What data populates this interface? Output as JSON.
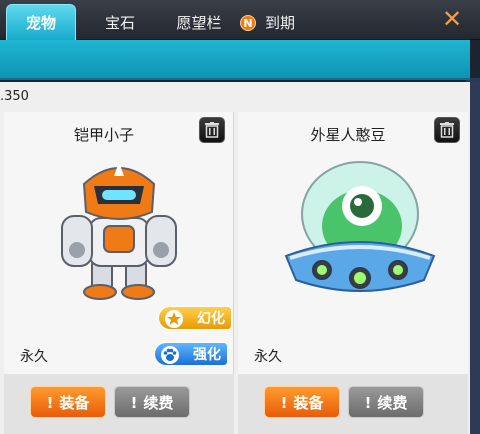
{
  "tabs": {
    "pets": "宠物",
    "gems": "宝石",
    "wishlist": "愿望栏",
    "expiring": "到期",
    "expiring_badge": "N"
  },
  "close_symbol": "✕",
  "count_text": ".350",
  "pets": [
    {
      "name": "铠甲小子",
      "duration": "永久",
      "morph_badge": "幻化",
      "enhance_badge": "强化",
      "equip_label": "装备",
      "renew_label": "续费"
    },
    {
      "name": "外星人憨豆",
      "duration": "永久",
      "equip_label": "装备",
      "renew_label": "续费"
    }
  ],
  "colors": {
    "active_tab": "#12a8c9",
    "equip_button": "#e85d09",
    "renew_button": "#6c6c6c",
    "morph_badge": "#e79a0a",
    "enhance_badge": "#1c6fd6"
  },
  "icons": [
    "n-badge-icon",
    "close-icon",
    "trash-icon",
    "star-icon",
    "paw-icon"
  ]
}
